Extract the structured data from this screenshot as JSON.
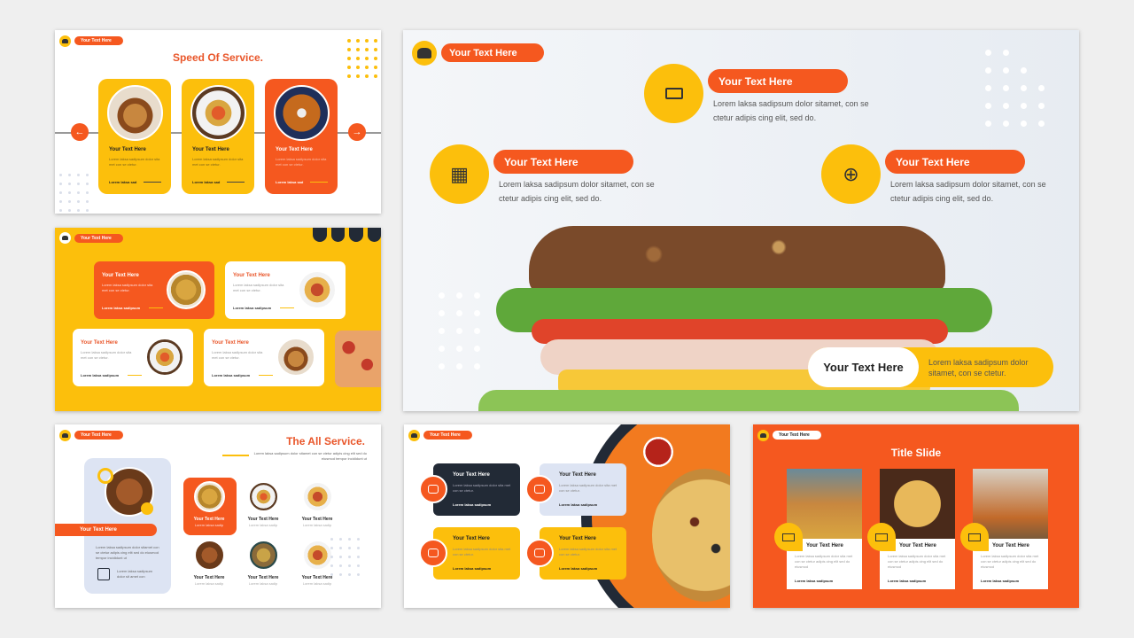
{
  "colors": {
    "orange": "#f5581f",
    "yellow": "#fcbf0c",
    "navy": "#222a36",
    "light_blue": "#dde4f3"
  },
  "common": {
    "tag": "Your Text Here",
    "heading": "Your Text Here",
    "lorem_short": "Lorem laksa sadipsum dolor sita met con se ctetur.",
    "footer": "Lorem laksa sadipsum",
    "footer_short": "Lorem laksa sad",
    "small": "Lorem laksa sadip"
  },
  "slide1": {
    "title": "Speed Of Service.",
    "icons": [
      "arrow-left-icon",
      "arrow-right-icon"
    ]
  },
  "slide3": {
    "title": "The All Service.",
    "subtitle": "Lorem laksa sadipsum dolor sitamet con se ctetur adipis cing elit sed do eiusmod tempor incididunt ut",
    "card_text": "Lorem laksa sadipsum dolor sitamet con se ctetur adipis cing elit sed do eiusmod tempor incididunt ut",
    "icon_text": "Lorem laksa sadipsum dolor sit amet con"
  },
  "slide5": {
    "title": "Title Slide",
    "card_text": "Lorem laksa sadipsum dolor sita met con se ctetur adipis cing elit sed do eiusmod",
    "icons": [
      "truck-icon",
      "cart-icon",
      "table-chairs-icon"
    ]
  },
  "main": {
    "tag": "Your Text Here",
    "items": [
      {
        "label": "Your Text Here",
        "text": "Lorem laksa sadipsum dolor sitamet, con se ctetur adipis cing elit, sed do.",
        "icon": "money-icon"
      },
      {
        "label": "Your Text Here",
        "text": "Lorem laksa sadipsum dolor sitamet, con se ctetur adipis cing elit, sed do.",
        "icon": "cart-icon"
      },
      {
        "label": "Your Text Here",
        "text": "Lorem laksa sadipsum dolor sitamet, con se ctetur adipis cing elit, sed do.",
        "icon": "globe-icon"
      }
    ],
    "bottom_label": "Your Text Here",
    "bottom_text": "Lorem laksa sadipsum dolor sitamet, con se ctetur."
  }
}
